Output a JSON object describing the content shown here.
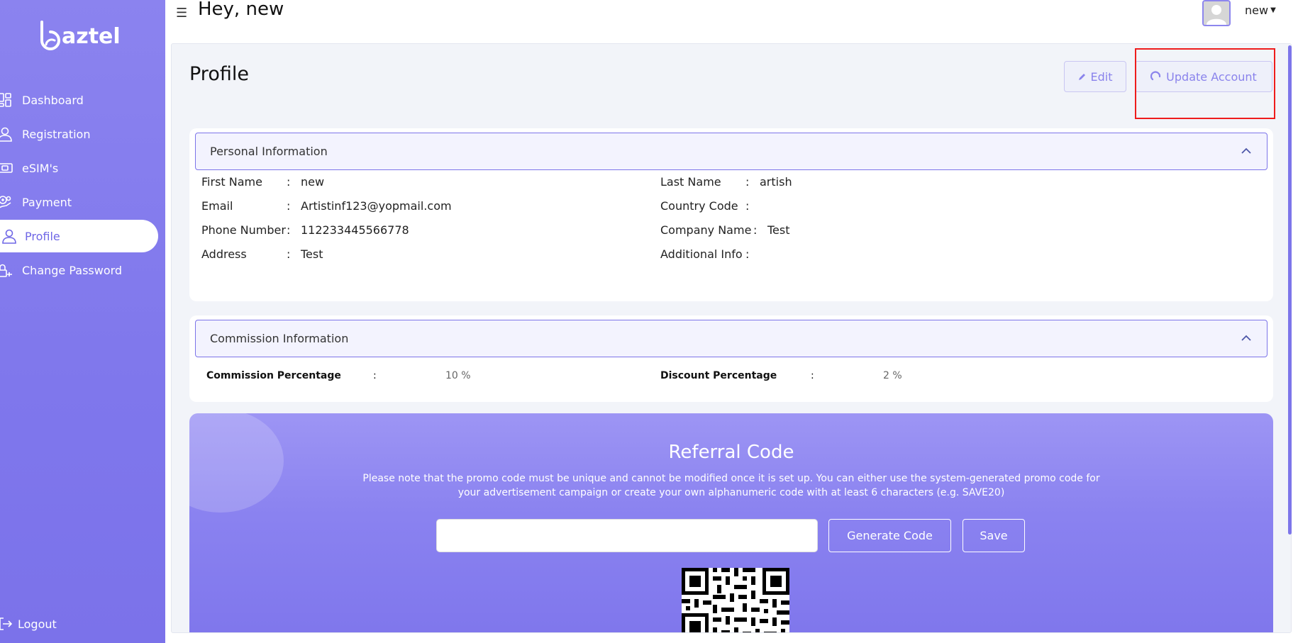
{
  "app": {
    "logo_text": "aztel",
    "greeting": "Hey, new",
    "user_name": "new"
  },
  "sidebar": {
    "items": [
      {
        "label": "Dashboard",
        "icon": "dashboard-icon",
        "active": false
      },
      {
        "label": "Registration",
        "icon": "user-icon",
        "active": false
      },
      {
        "label": "eSIM's",
        "icon": "sim-icon",
        "active": false
      },
      {
        "label": "Payment",
        "icon": "payment-icon",
        "active": false
      },
      {
        "label": "Profile",
        "icon": "profile-icon",
        "active": true
      },
      {
        "label": "Change Password",
        "icon": "password-icon",
        "active": false
      }
    ],
    "logout_label": "Logout"
  },
  "page": {
    "title": "Profile",
    "edit_label": "Edit",
    "update_label": "Update Account"
  },
  "personal": {
    "heading": "Personal Information",
    "left": [
      {
        "label": "First Name",
        "value": "new"
      },
      {
        "label": "Email",
        "value": "Artistinf123@yopmail.com"
      },
      {
        "label": "Phone Number",
        "value": "112233445566778"
      },
      {
        "label": "Address",
        "value": "Test"
      }
    ],
    "right": [
      {
        "label": "Last Name",
        "value": "artish"
      },
      {
        "label": "Country Code",
        "value": ""
      },
      {
        "label": "Company Name",
        "value": "Test"
      },
      {
        "label": "Additional Info",
        "value": ""
      }
    ]
  },
  "commission": {
    "heading": "Commission Information",
    "commission_label": "Commission Percentage",
    "commission_value": "10 %",
    "discount_label": "Discount Percentage",
    "discount_value": "2 %"
  },
  "referral": {
    "title": "Referral Code",
    "note": "Please note that the promo code must be unique and cannot be modified once it is set up. You can either use the system-generated promo code for your advertisement campaign or create your own alphanumeric code with at least 6 characters (e.g. SAVE20)",
    "input_value": "",
    "generate_label": "Generate Code",
    "save_label": "Save"
  },
  "colors": {
    "sidebar": "#8078ec",
    "accent": "#7c74e9",
    "highlight": "#ee1c1c"
  }
}
